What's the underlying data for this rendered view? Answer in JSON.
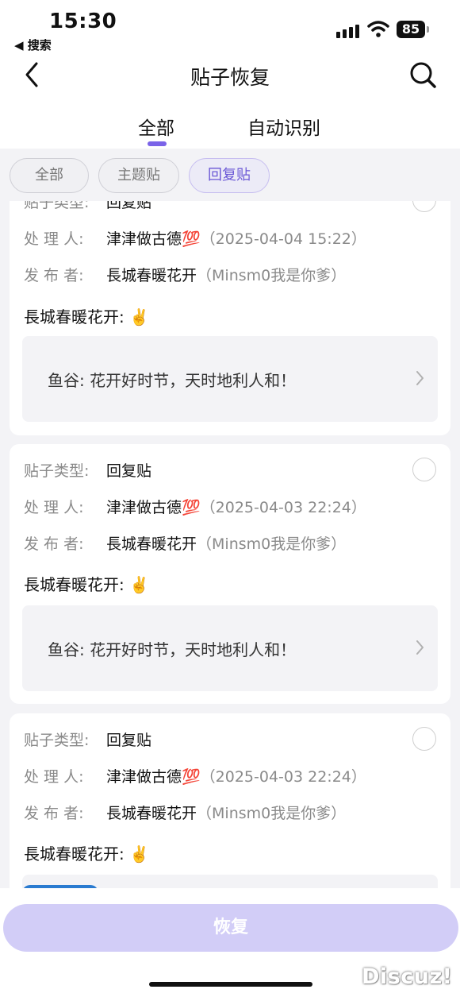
{
  "status_bar": {
    "time": "15:30",
    "back_app": "◀ 搜索",
    "battery": "85",
    "icons": [
      "signal-icon",
      "wifi-icon",
      "battery-icon"
    ]
  },
  "header": {
    "title": "贴子恢复",
    "back_icon": "chevron-left-icon",
    "search_icon": "search-icon"
  },
  "tabs": [
    {
      "label": "全部",
      "active": true
    },
    {
      "label": "自动识别",
      "active": false
    }
  ],
  "filters": [
    {
      "label": "全部",
      "selected": false
    },
    {
      "label": "主题贴",
      "selected": false
    },
    {
      "label": "回复贴",
      "selected": true
    }
  ],
  "labels": {
    "type": "贴子类型:",
    "handler": "处 理 人:",
    "publisher": "发 布 者:"
  },
  "cards": [
    {
      "type": "回复贴",
      "handler": "津津做古德💯",
      "time": "（2025-04-04 15:22）",
      "publisher": "長城春暖花开",
      "publisher_id": "（Minsm0我是你爹）",
      "author_line": "長城春暖花开: ✌️",
      "quote": "鱼谷: 花开好时节，天时地利人和！"
    },
    {
      "type": "回复贴",
      "handler": "津津做古德💯",
      "time": "（2025-04-03 22:24）",
      "publisher": "長城春暖花开",
      "publisher_id": "（Minsm0我是你爹）",
      "author_line": "長城春暖花开: ✌️",
      "quote": "鱼谷: 花开好时节，天时地利人和！"
    },
    {
      "type": "回复贴",
      "handler": "津津做古德💯",
      "time": "（2025-04-03 22:24）",
      "publisher": "長城春暖花开",
      "publisher_id": "（Minsm0我是你爹）",
      "author_line": "長城春暖花开: ✌️"
    }
  ],
  "footer": {
    "restore_label": "恢复",
    "watermark": "Discuz!"
  },
  "colors": {
    "accent": "#7a63e8",
    "restore_button": "#d2cdf7",
    "background": "#f3f3f6"
  }
}
